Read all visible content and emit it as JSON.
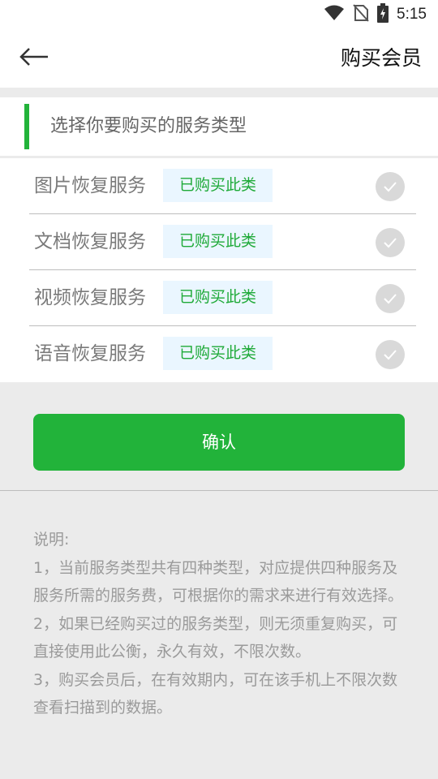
{
  "status_bar": {
    "time": "5:15",
    "icons": [
      "wifi-icon",
      "no-sim-icon",
      "battery-charging-icon"
    ]
  },
  "header": {
    "back_icon": "arrow-left-icon",
    "title": "购买会员"
  },
  "section": {
    "title": "选择你要购买的服务类型"
  },
  "services": [
    {
      "name": "图片恢复服务",
      "badge": "已购买此类",
      "checked": true
    },
    {
      "name": "文档恢复服务",
      "badge": "已购买此类",
      "checked": true
    },
    {
      "name": "视频恢复服务",
      "badge": "已购买此类",
      "checked": true
    },
    {
      "name": "语音恢复服务",
      "badge": "已购买此类",
      "checked": true
    }
  ],
  "confirm": {
    "label": "确认"
  },
  "notes": {
    "heading": "说明:",
    "line1": "1，当前服务类型共有四种类型，对应提供四种服务及服务所需的服务费，可根据你的需求来进行有效选择。",
    "line2": "2，如果已经购买过的服务类型，则无须重复购买，可直接使用此公衡，永久有效，不限次数。",
    "line3": "3，购买会员后，在有效期内，可在该手机上不限次数查看扫描到的数据。"
  },
  "colors": {
    "accent": "#22b33a",
    "badge_bg": "#eaf6ff",
    "check_bg": "#d9d9d9",
    "page_bg": "#ebebeb"
  }
}
